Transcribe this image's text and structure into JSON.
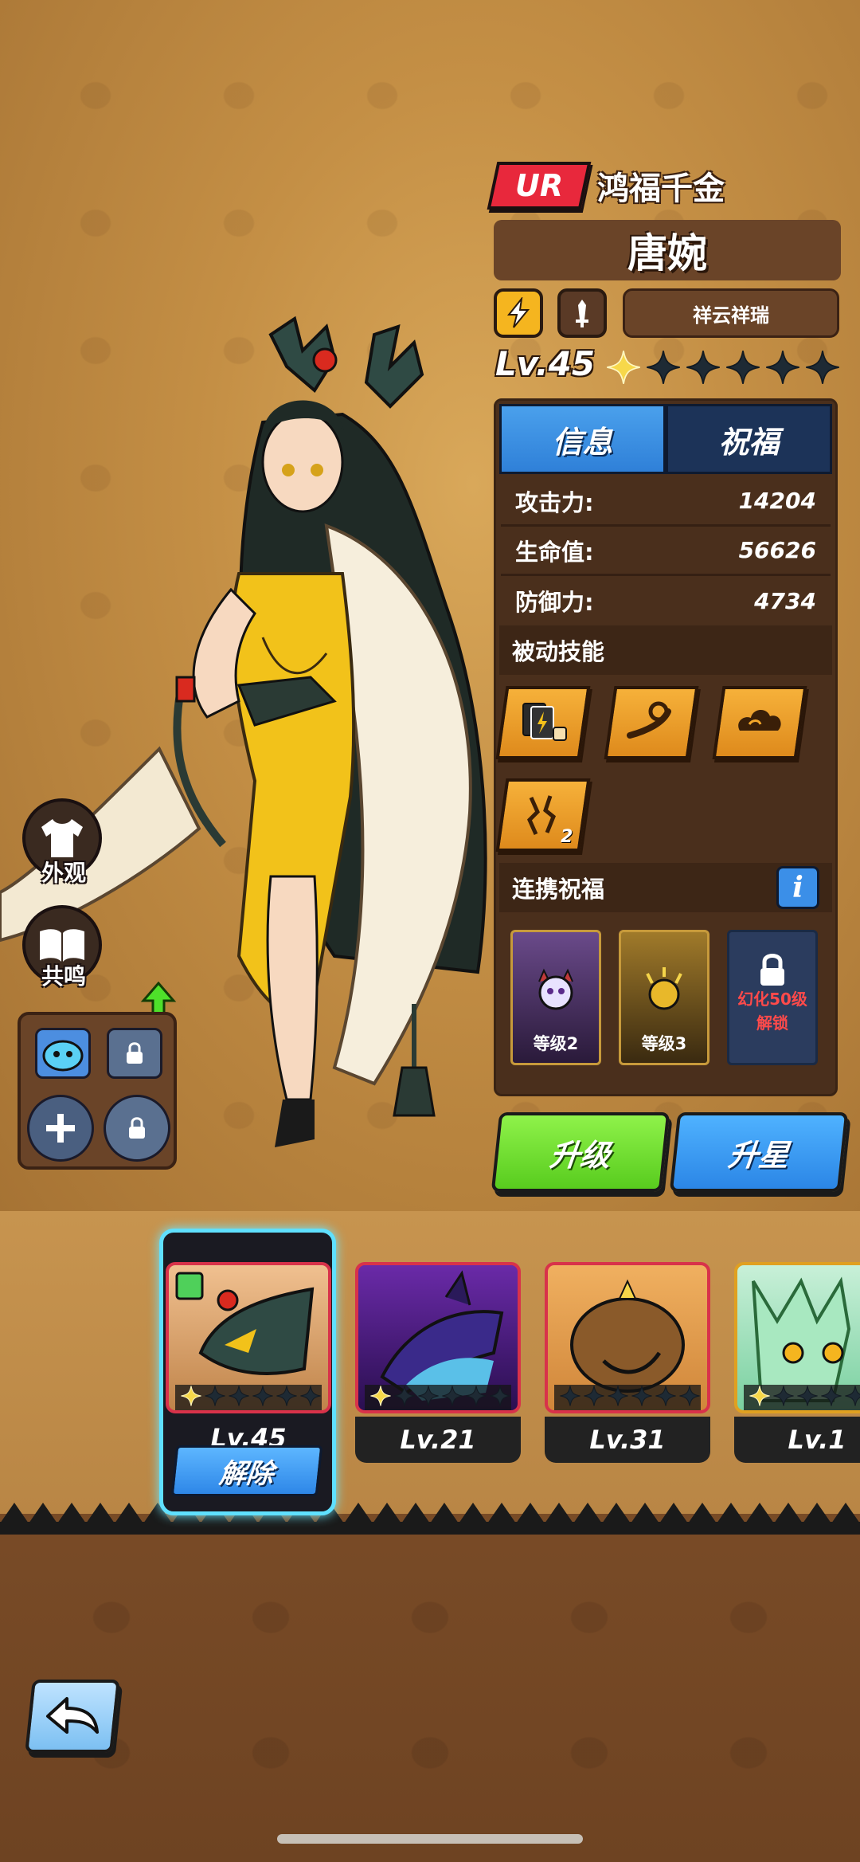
{
  "hero": {
    "rarity": "UR",
    "title": "鸿福千金",
    "name": "唐婉",
    "set_name": "祥云祥瑞",
    "level_label": "Lv.45",
    "stars_filled": 1,
    "stars_total": 6
  },
  "tabs": [
    {
      "label": "信息",
      "active": true
    },
    {
      "label": "祝福",
      "active": false
    }
  ],
  "stats": [
    {
      "key": "攻击力:",
      "value": "14204"
    },
    {
      "key": "生命值:",
      "value": "56626"
    },
    {
      "key": "防御力:",
      "value": "4734"
    }
  ],
  "passive_title": "被动技能",
  "skills": [
    {
      "icon": "cards-dice-icon",
      "badge": ""
    },
    {
      "icon": "wind-swirl-icon",
      "badge": ""
    },
    {
      "icon": "cloud-icon",
      "badge": ""
    },
    {
      "icon": "crack-icon",
      "badge": "2"
    }
  ],
  "bond_title": "连携祝福",
  "bond_info": "i",
  "bonds": [
    {
      "level": "等级2",
      "icon": "demon-icon"
    },
    {
      "level": "等级3",
      "icon": "gold-lightning-icon"
    }
  ],
  "bond_locked_text_1": "幻化50级",
  "bond_locked_text_2": "解锁",
  "buttons": {
    "upgrade": "升级",
    "star_up": "升星",
    "appearance": "外观",
    "resonance": "共鸣",
    "release": "解除"
  },
  "carousel": [
    {
      "level": "Lv.45",
      "stars_filled": 1,
      "selected": true,
      "frame_color": "#d8324a"
    },
    {
      "level": "Lv.21",
      "stars_filled": 1,
      "selected": false,
      "frame_color": "#d8324a"
    },
    {
      "level": "Lv.31",
      "stars_filled": 0,
      "selected": false,
      "frame_color": "#d8324a"
    },
    {
      "level": "Lv.1",
      "stars_filled": 1,
      "selected": false,
      "frame_color": "#e0a020"
    }
  ],
  "colors": {
    "accent_red": "#e8283c",
    "upgrade_green": "#58cc1e",
    "starup_blue": "#2b86e6",
    "selected_glow": "#5fe0ff"
  }
}
